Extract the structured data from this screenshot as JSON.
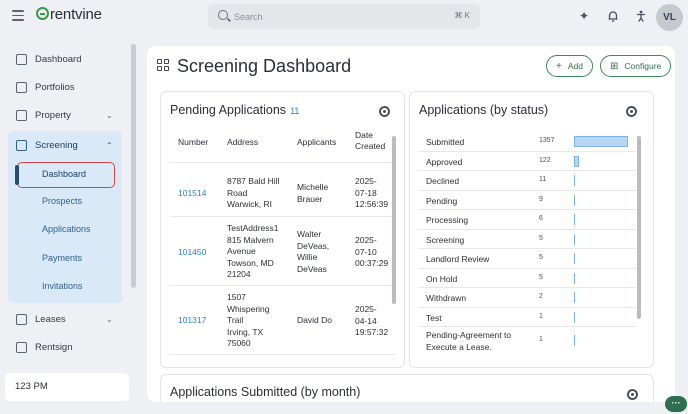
{
  "header": {
    "brand": "rentvine",
    "search_placeholder": "Search",
    "search_shortcut": "⌘ K",
    "avatar_initials": "VL",
    "icons": [
      "menu-icon",
      "sparkle-icon",
      "bell-icon",
      "accessibility-icon"
    ]
  },
  "sidebar": {
    "items": [
      {
        "label": "Dashboard",
        "icon": "dashboard-icon"
      },
      {
        "label": "Portfolios",
        "icon": "portfolios-icon"
      },
      {
        "label": "Property",
        "icon": "property-icon"
      },
      {
        "label": "Screening",
        "icon": "screening-icon"
      },
      {
        "label": "Leases",
        "icon": "leases-icon"
      },
      {
        "label": "Rentsign",
        "icon": "rentsign-icon"
      }
    ],
    "screening_sub": [
      "Dashboard",
      "Prospects",
      "Applications",
      "Payments",
      "Invitations"
    ],
    "time": "123 PM"
  },
  "page": {
    "title": "Screening Dashboard",
    "add_label": "Add",
    "configure_label": "Configure"
  },
  "pending": {
    "title": "Pending Applications",
    "count": "11",
    "headers": [
      "Number",
      "Address",
      "Applicants",
      "Date Created"
    ],
    "rows": [
      {
        "number": "101514",
        "address": [
          "8787 Bald Hill",
          "Road",
          "Warwick, RI"
        ],
        "applicants": [
          "Michelle",
          "Brauer"
        ],
        "date": [
          "2025-",
          "07-18",
          "12:56:39"
        ]
      },
      {
        "number": "101450",
        "address": [
          "TestAddress1",
          "815 Malvern",
          "Avenue",
          "Towson, MD",
          "21204"
        ],
        "applicants": [
          "Walter",
          "DeVeas,",
          "Willie",
          "DeVeas"
        ],
        "date": [
          "2025-",
          "07-10",
          "00:37:29"
        ]
      },
      {
        "number": "101317",
        "address": [
          "1507",
          "Whispering",
          "Trail",
          "Irving, TX",
          "75060"
        ],
        "applicants": [
          "David Do"
        ],
        "date": [
          "2025-",
          "04-14",
          "19:57:32"
        ]
      }
    ]
  },
  "status": {
    "title": "Applications (by status)",
    "rows": [
      {
        "label": "Submitted",
        "value": 1357
      },
      {
        "label": "Approved",
        "value": 122
      },
      {
        "label": "Declined",
        "value": 11
      },
      {
        "label": "Pending",
        "value": 9
      },
      {
        "label": "Processing",
        "value": 6
      },
      {
        "label": "Screening",
        "value": 5
      },
      {
        "label": "Landlord Review",
        "value": 5
      },
      {
        "label": "On Hold",
        "value": 5
      },
      {
        "label": "Withdrawn",
        "value": 2
      },
      {
        "label": "Test",
        "value": 1
      },
      {
        "label": "Pending-Agreement to Execute a Lease.",
        "value": 1
      }
    ]
  },
  "monthly": {
    "title": "Applications Submitted (by month)"
  },
  "colors": {
    "accent_green": "#3a8a56",
    "link_blue": "#2f7fbf",
    "active_group_bg": "#d9e9f8",
    "highlight_red": "#d4464b"
  }
}
